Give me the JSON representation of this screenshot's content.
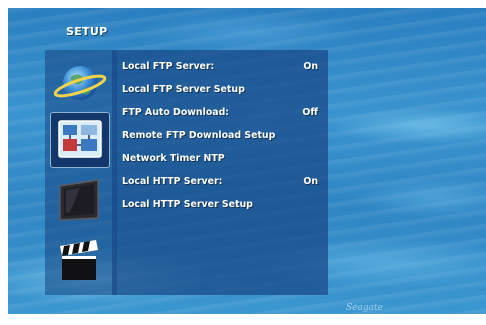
{
  "title": "SETUP",
  "sidebar": {
    "items": [
      {
        "name": "network-globe-icon"
      },
      {
        "name": "network-settings-icon",
        "selected": true
      },
      {
        "name": "tv-display-icon"
      },
      {
        "name": "clapperboard-icon"
      }
    ]
  },
  "menu": {
    "items": [
      {
        "label": "Local FTP Server:",
        "value": "On"
      },
      {
        "label": "Local FTP Server Setup",
        "value": ""
      },
      {
        "label": "FTP Auto Download:",
        "value": "Off"
      },
      {
        "label": "Remote FTP Download Setup",
        "value": ""
      },
      {
        "label": "Network Timer NTP",
        "value": ""
      },
      {
        "label": "Local HTTP Server:",
        "value": "On"
      },
      {
        "label": "Local HTTP Server Setup",
        "value": ""
      }
    ]
  },
  "watermark": "Seagate"
}
